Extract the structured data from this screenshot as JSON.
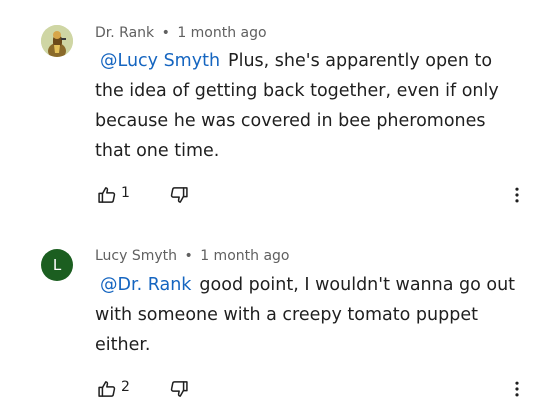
{
  "comments": [
    {
      "author": "Dr. Rank",
      "separator": "•",
      "time": "1 month ago",
      "mention": "@Lucy Smyth",
      "text": "Plus, she's apparently open to the idea of getting back together, even if only because he was covered in bee pheromones that one time.",
      "likes": "1",
      "avatar_icon": "profile-picture-icon"
    },
    {
      "author": "Lucy Smyth",
      "separator": "•",
      "time": "1 month ago",
      "mention": "@Dr. Rank",
      "text": "good point, I wouldn't wanna go out with someone with a creepy tomato puppet either.",
      "likes": "2",
      "avatar_letter": "L"
    }
  ],
  "colors": {
    "mention": "#1565c0",
    "avatar_letter_bg": "#1b5e20",
    "meta": "#606060"
  }
}
